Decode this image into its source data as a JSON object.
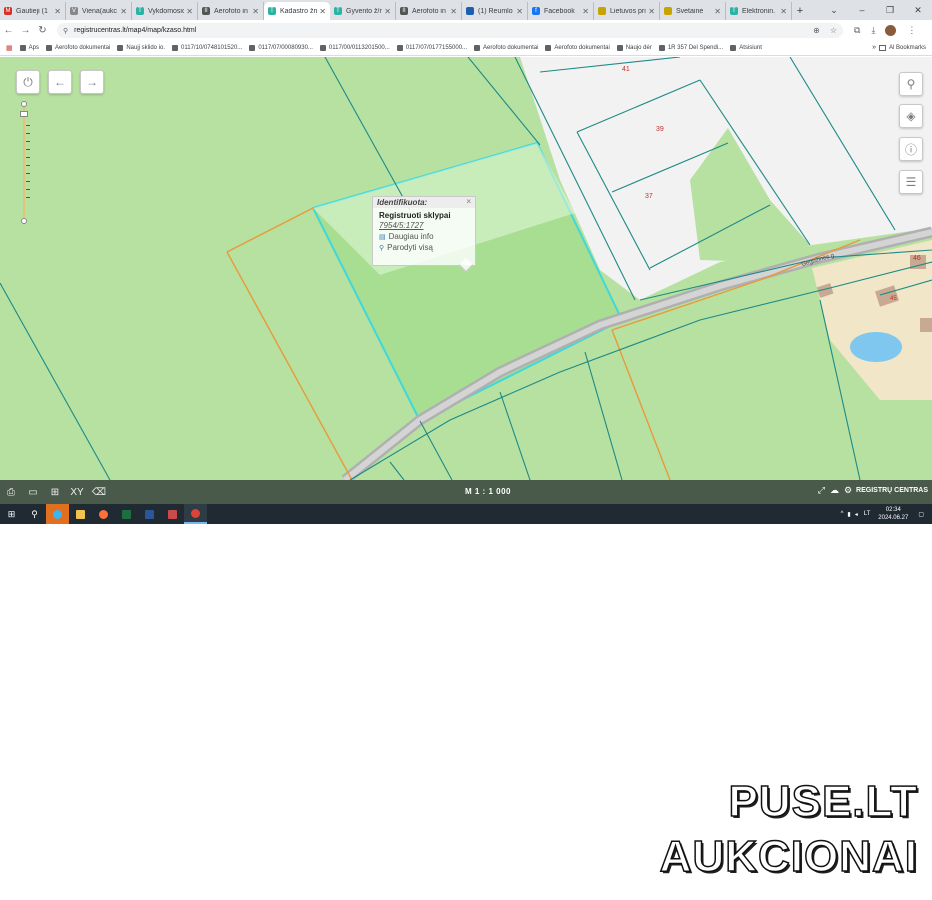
{
  "browser": {
    "tabs": [
      {
        "title": "Gautieji (1",
        "color": "#d93025",
        "glyph": "M",
        "active": false
      },
      {
        "title": "Viena(aukc",
        "color": "#888888",
        "glyph": "V",
        "active": false
      },
      {
        "title": "Vykdomosio",
        "color": "#2bb3a3",
        "glyph": "T",
        "active": false
      },
      {
        "title": "Aerofoto in",
        "color": "#555555",
        "glyph": "II",
        "active": false
      },
      {
        "title": "Kadastro žm",
        "color": "#2bb3a3",
        "glyph": "T",
        "active": true
      },
      {
        "title": "Gyvento ž/n",
        "color": "#2bb3a3",
        "glyph": "T",
        "active": false
      },
      {
        "title": "Aerofoto in",
        "color": "#555555",
        "glyph": "II",
        "active": false
      },
      {
        "title": "(1) Reumlo",
        "color": "#1a5fb4",
        "glyph": "",
        "active": false
      },
      {
        "title": "Facebook",
        "color": "#1877f2",
        "glyph": "f",
        "active": false
      },
      {
        "title": "Lietuvos pri",
        "color": "#c8a400",
        "glyph": "",
        "active": false
      },
      {
        "title": "Svetainė",
        "color": "#c8a400",
        "glyph": "",
        "active": false
      },
      {
        "title": "Elektronin.",
        "color": "#2bb3a3",
        "glyph": "T",
        "active": false
      }
    ],
    "new_tab": "+",
    "window_controls": [
      "⌄",
      "–",
      "❐",
      "✕"
    ],
    "url": "registrucentras.lt/map4/map/kzaso.html",
    "bookmarks": [
      "Aps",
      "Aerofoto dokumentai",
      "Naujį sklido io.",
      "0117/10/0748101520...",
      "0117/07/00080930...",
      "0117/00/0113201500...",
      "0117/07/0177155000...",
      "Aerofoto dokumentai",
      "Aerofoto dokumentai",
      "Naujo dėr",
      "1R 357 Del Spendi...",
      "Atsisiunt"
    ],
    "bookmarks_more": "»",
    "all_bookmarks": "Al Bookmarks"
  },
  "map": {
    "parcel_labels": [
      "41",
      "39",
      "37",
      "46",
      "45"
    ],
    "street_name": "Gegužinės g.",
    "popup": {
      "header": "Identifikuota:",
      "close": "×",
      "title": "Registruoti sklypai",
      "parcel_id": "7954/5:1727",
      "more_info": "Daugiau info",
      "show_all": "Parodyti visą"
    },
    "scale": "M 1 : 1 000",
    "brand": "REGISTRŲ CENTRAS"
  },
  "taskbar": {
    "language": "LT",
    "time": "02:34",
    "date": "2024.06.27"
  },
  "watermark": {
    "line1": "PUSE.LT",
    "line2": "AUKCIONAI"
  }
}
